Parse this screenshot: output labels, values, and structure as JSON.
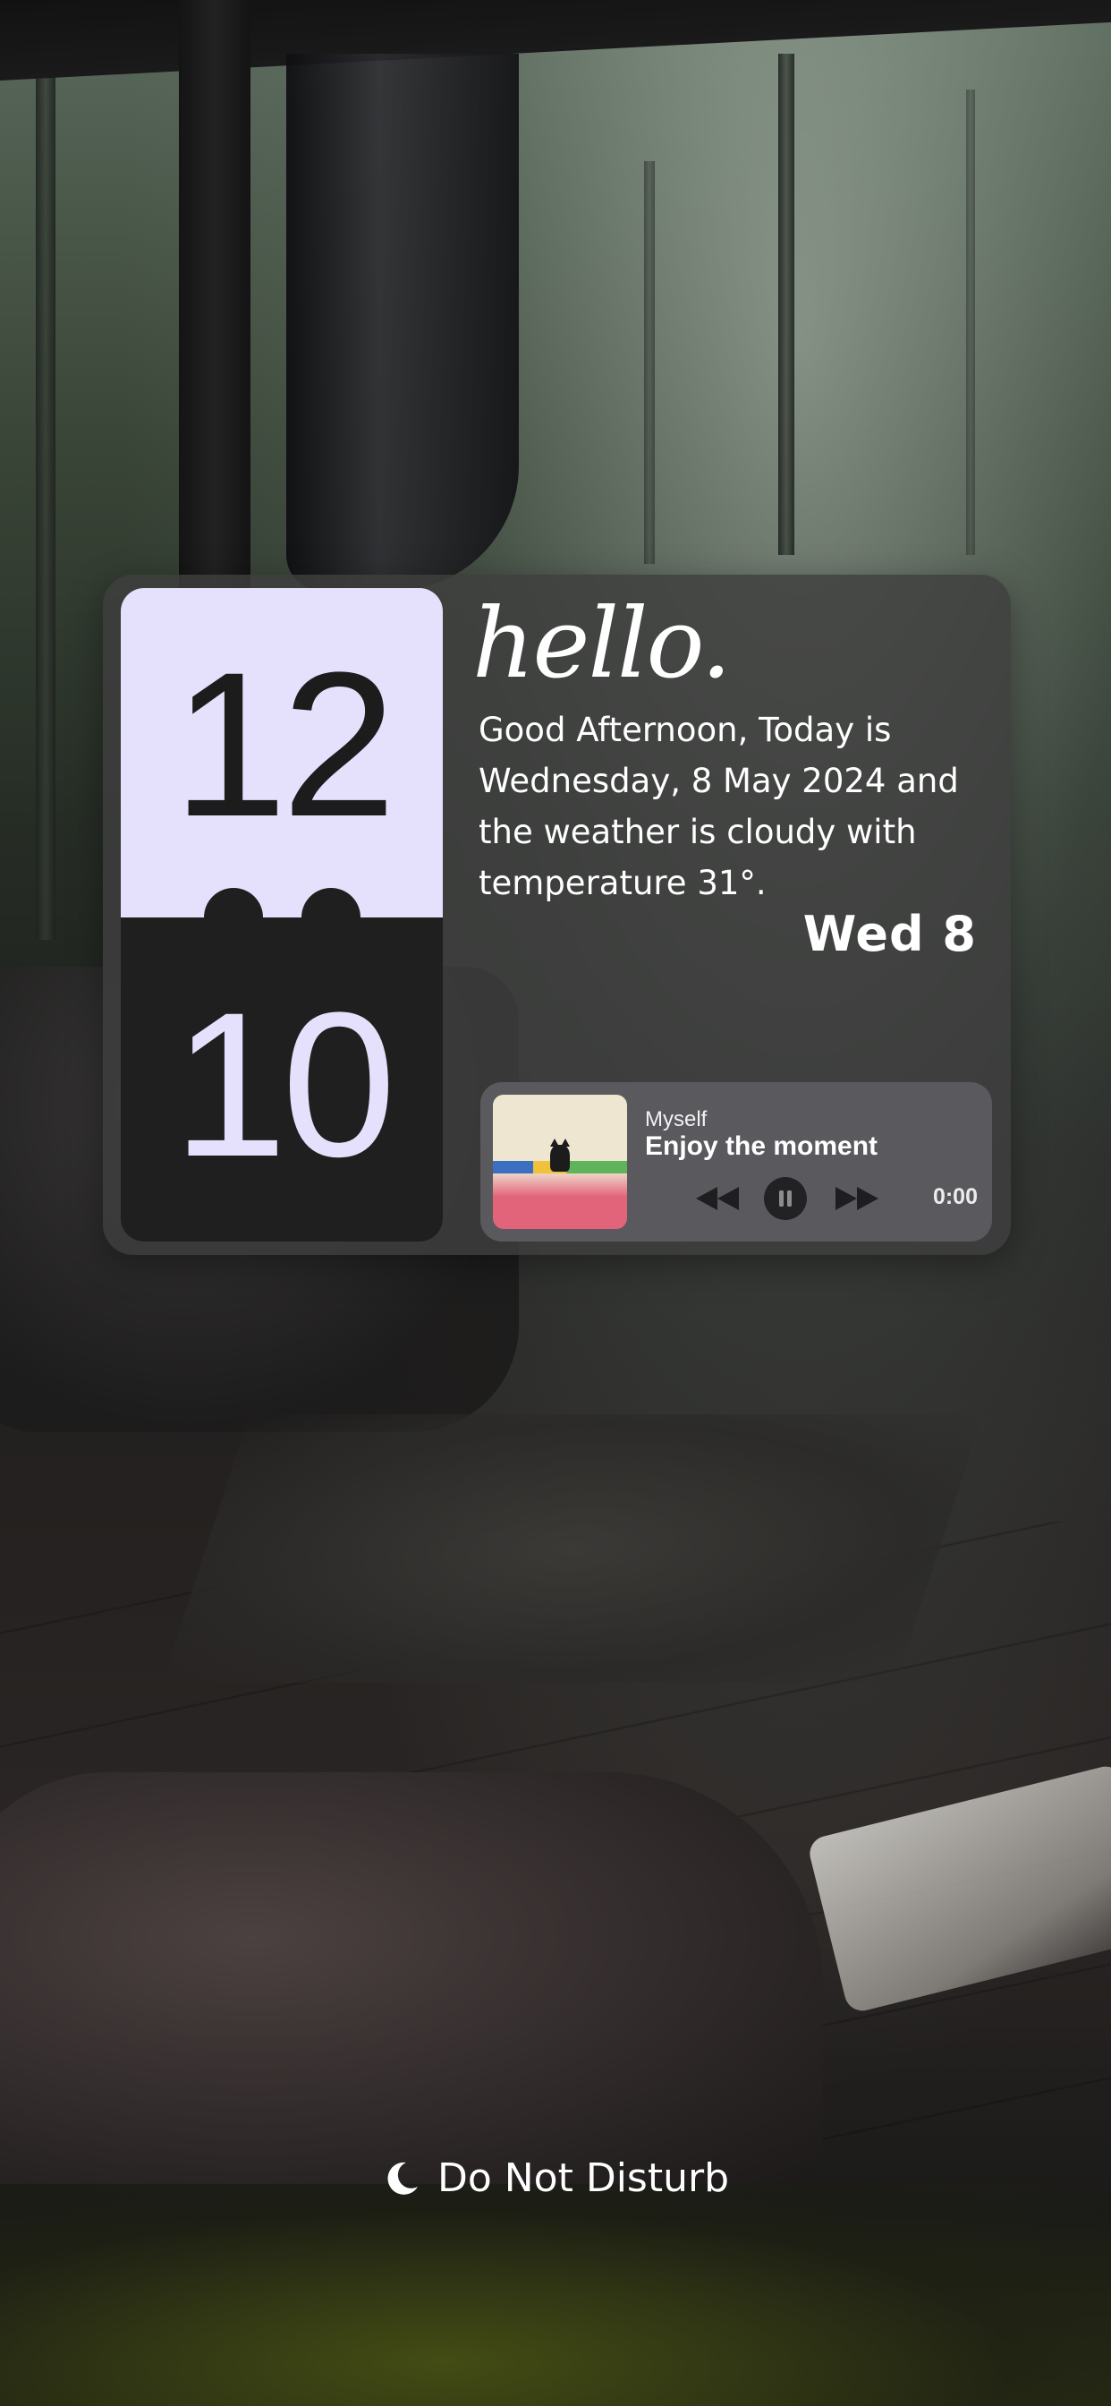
{
  "clock": {
    "hour": "12",
    "minute": "10"
  },
  "greeting": {
    "hello": "hello.",
    "message": "Good Afternoon, Today is Wednesday, 8 May 2024 and the weather is cloudy with temperature 31°.",
    "date_short": "Wed 8"
  },
  "player": {
    "artist": "Myself",
    "title": "Enjoy the moment",
    "elapsed": "0:00",
    "state": "playing",
    "controls": [
      "rewind-icon",
      "pause-icon",
      "fast-forward-icon"
    ]
  },
  "status": {
    "dnd_label": "Do Not Disturb",
    "dnd_icon": "moon-icon"
  },
  "colors": {
    "clock_light": "#e5e0fb",
    "clock_dark": "#1f1f1f",
    "widget_bg": "#3e3e3e",
    "player_bg": "#5a5a5e"
  }
}
